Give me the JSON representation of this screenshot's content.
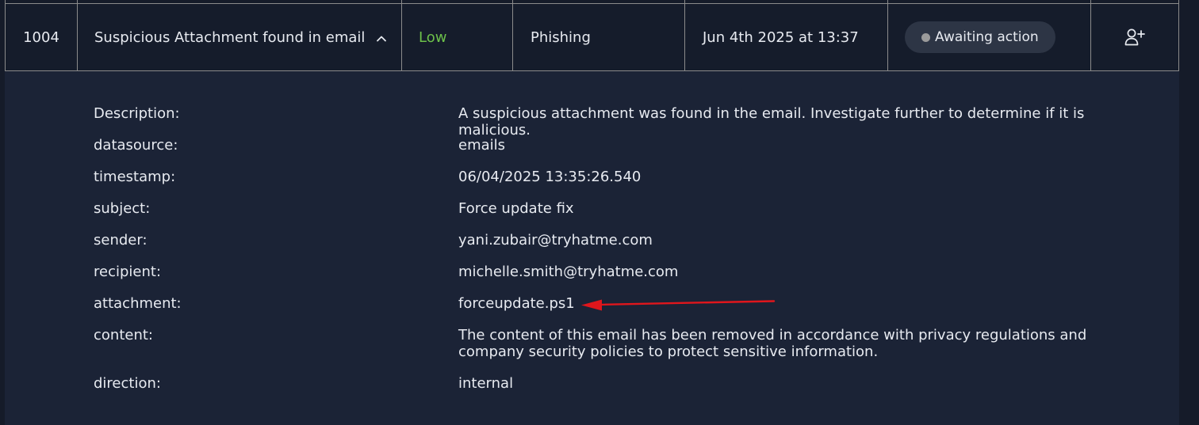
{
  "alert": {
    "id": "1004",
    "title": "Suspicious Attachment found in email",
    "severity": "Low",
    "severity_color": "#6cc04a",
    "type": "Phishing",
    "date": "Jun 4th 2025 at 13:37",
    "status": "Awaiting action",
    "status_dot_color": "#9b9b9b",
    "expand_icon": "chevron-up-icon",
    "assign_icon": "user-plus-icon"
  },
  "details": [
    {
      "key": "Description:",
      "value": "A suspicious attachment was found in the email. Investigate further to determine if it is malicious."
    },
    {
      "key": "datasource:",
      "value": "emails"
    },
    {
      "key": "timestamp:",
      "value": "06/04/2025 13:35:26.540"
    },
    {
      "key": "subject:",
      "value": "Force update fix"
    },
    {
      "key": "sender:",
      "value": "yani.zubair@tryhatme.com"
    },
    {
      "key": "recipient:",
      "value": "michelle.smith@tryhatme.com"
    },
    {
      "key": "attachment:",
      "value": "forceupdate.ps1"
    },
    {
      "key": "content:",
      "value": "The content of this email has been removed in accordance with privacy regulations and company security policies to protect sensitive information."
    },
    {
      "key": "direction:",
      "value": "internal"
    }
  ],
  "annotation": {
    "arrow_color": "#e0161c"
  }
}
